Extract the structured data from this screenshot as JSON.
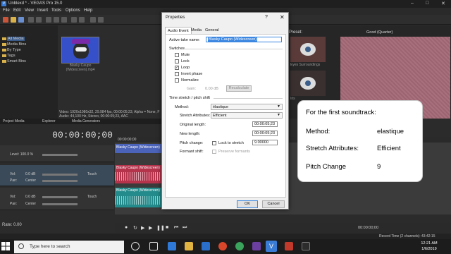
{
  "window": {
    "title": "Unblexd * - VEGAS Pro 15.0"
  },
  "menu": [
    "File",
    "Edit",
    "View",
    "Insert",
    "Tools",
    "Options",
    "Help"
  ],
  "media_tree": [
    "All Media",
    "Media Bins",
    "By Type",
    "Tags",
    "Smart Bins"
  ],
  "media_thumb_caption": "Blasky Caupo (Widescreen).mp4",
  "media_info": [
    "Video: 1920x1080x32, 29.984 fps, 00:00:05;23, Alpha = None, F",
    "Audio: 44,100 Hz, Stereo, 00:00:05;23, AAC"
  ],
  "panel_tabs": [
    "Project Media",
    "Explorer",
    "Media Generators"
  ],
  "preview": {
    "label": "Preset:",
    "quality": "Good (Quarter)"
  },
  "eye_captions": [
    "Eyes Surroundings",
    "Iris"
  ],
  "timeline": {
    "timecode": "00:00:00;00",
    "ruler_start": "00:00:00;00",
    "video_level": "Level: 100.0 %",
    "audio_labels": {
      "vol": "Vol:",
      "vol_val": "0.0 dB",
      "pan": "Pan:",
      "pan_val": "Center",
      "touch": "Touch"
    },
    "clip_name": "Blasky Caupo (Widescreen)",
    "rate": "Rate: 0.00",
    "bottom_timecode": "00:00:00;00",
    "record_time": "Record Time (2 channels): 43:42:15"
  },
  "dialog": {
    "title": "Properties",
    "help": "?",
    "tabs": [
      "Audio Event",
      "Media",
      "General"
    ],
    "active_take_label": "Active take name:",
    "active_take_value": "Blasky Caupo (Widescreen)",
    "switches_label": "Switches",
    "switches": [
      {
        "label": "Mute",
        "checked": false
      },
      {
        "label": "Lock",
        "checked": false
      },
      {
        "label": "Loop",
        "checked": true
      },
      {
        "label": "Invert phase",
        "checked": false
      },
      {
        "label": "Normalize",
        "checked": false
      }
    ],
    "gain_label": "Gain:",
    "gain_value": "0.00 dB",
    "recalc_label": "Recalculate",
    "stretch_label": "Time stretch / pitch shift",
    "method_label": "Method:",
    "method_value": "élastique",
    "stretch_attr_label": "Stretch Attributes:",
    "stretch_attr_value": "Efficient",
    "orig_len_label": "Original length:",
    "orig_len_value": "00:00:05;23",
    "new_len_label": "New length:",
    "new_len_value": "00:00:05;23",
    "pitch_label": "Pitch change:",
    "pitch_value": "9.00000",
    "lock_label": "Lock to stretch",
    "formant_label": "Formant shift:",
    "preserve_label": "Preserve formants",
    "ok": "OK",
    "cancel": "Cancel"
  },
  "callout": {
    "heading": "For the first soundtrack:",
    "method_label": "Method:",
    "method_value": "elastique",
    "stretch_label": "Stretch Attributes:",
    "stretch_value": "Efficient",
    "pitch_label": "Pitch Change",
    "pitch_value": "9"
  },
  "taskbar": {
    "search_placeholder": "Type here to search",
    "time": "12:21 AM",
    "date": "1/6/2019"
  },
  "colors": {
    "accent": "#3a86e0",
    "video_clip": "#4b63b8",
    "audio_clip1": "#b6334c",
    "audio_clip2": "#238b8b"
  }
}
